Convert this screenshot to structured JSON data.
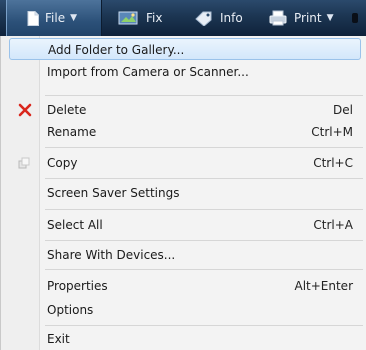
{
  "toolbar": {
    "file": "File",
    "fix": "Fix",
    "info": "Info",
    "print": "Print"
  },
  "menu": {
    "add_folder": "Add Folder to Gallery...",
    "import": "Import from Camera or Scanner...",
    "delete": "Delete",
    "delete_sc": "Del",
    "rename": "Rename",
    "rename_sc": "Ctrl+M",
    "copy": "Copy",
    "copy_sc": "Ctrl+C",
    "screensaver": "Screen Saver Settings",
    "select_all": "Select All",
    "select_all_sc": "Ctrl+A",
    "share": "Share With Devices...",
    "properties": "Properties",
    "properties_sc": "Alt+Enter",
    "options": "Options",
    "exit": "Exit"
  },
  "colors": {
    "toolbar_bg": "#1c3552",
    "menu_bg": "#f3f3f3",
    "hover_border": "#9ac2ea",
    "delete_icon": "#d9261c"
  }
}
